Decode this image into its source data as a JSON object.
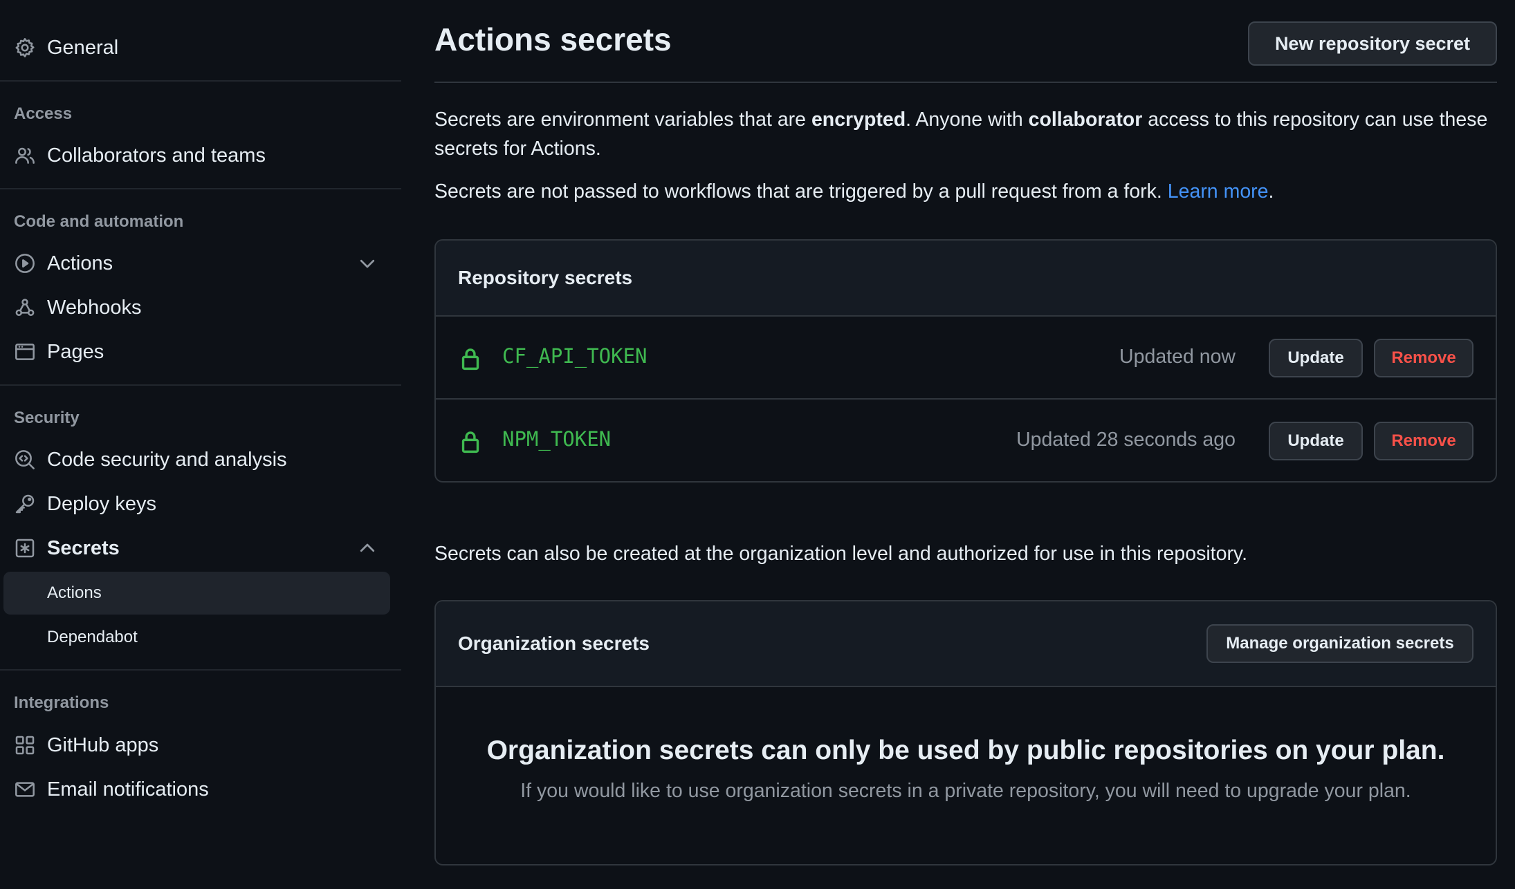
{
  "sidebar": {
    "general": {
      "label": "General",
      "icon": "gear-icon"
    },
    "sections": [
      {
        "heading": "Access"
      },
      {
        "heading": "Code and automation"
      },
      {
        "heading": "Security"
      },
      {
        "heading": "Integrations"
      }
    ],
    "items": {
      "collaborators": {
        "label": "Collaborators and teams",
        "icon": "people-icon"
      },
      "actions": {
        "label": "Actions",
        "icon": "play-icon",
        "chevron": "chevron-down-icon"
      },
      "webhooks": {
        "label": "Webhooks",
        "icon": "webhook-icon"
      },
      "pages": {
        "label": "Pages",
        "icon": "browser-icon"
      },
      "code_security": {
        "label": "Code security and analysis",
        "icon": "codescan-icon"
      },
      "deploy_keys": {
        "label": "Deploy keys",
        "icon": "key-icon"
      },
      "secrets": {
        "label": "Secrets",
        "icon": "asterisk-icon",
        "chevron": "chevron-up-icon",
        "expanded": true
      },
      "secrets_actions": {
        "label": "Actions",
        "selected": true
      },
      "secrets_dependabot": {
        "label": "Dependabot"
      },
      "github_apps": {
        "label": "GitHub apps",
        "icon": "apps-icon"
      },
      "email_notifications": {
        "label": "Email notifications",
        "icon": "mail-icon"
      }
    }
  },
  "main": {
    "title": "Actions secrets",
    "new_secret_button": "New repository secret",
    "intro": {
      "part1": "Secrets are environment variables that are ",
      "bold1": "encrypted",
      "part2": ". Anyone with ",
      "bold2": "collaborator",
      "part3": " access to this repository can use these secrets for Actions."
    },
    "fork_note": {
      "text": "Secrets are not passed to workflows that are triggered by a pull request from a fork. ",
      "link": "Learn more",
      "end": "."
    },
    "repository_secrets": {
      "title": "Repository secrets",
      "rows": [
        {
          "name": "CF_API_TOKEN",
          "updated": "Updated now",
          "update_label": "Update",
          "remove_label": "Remove"
        },
        {
          "name": "NPM_TOKEN",
          "updated": "Updated 28 seconds ago",
          "update_label": "Update",
          "remove_label": "Remove"
        }
      ]
    },
    "org_note": "Secrets can also be created at the organization level and authorized for use in this repository.",
    "organization_secrets": {
      "title": "Organization secrets",
      "manage_button": "Manage organization secrets",
      "blank_title": "Organization secrets can only be used by public repositories on your plan.",
      "blank_text": "If you would like to use organization secrets in a private repository, you will need to upgrade your plan."
    }
  },
  "colors": {
    "background": "#0d1117",
    "header_background": "#151b23",
    "border": "#30363d",
    "accent_link": "#4493f8",
    "secret_green": "#3fb950",
    "danger": "#f85149",
    "muted": "#9198a1"
  }
}
